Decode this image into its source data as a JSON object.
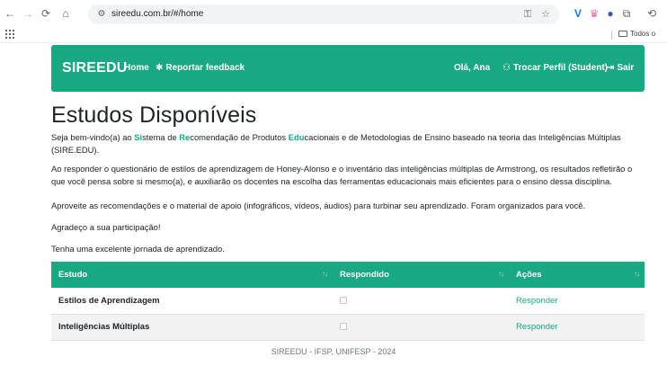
{
  "browser": {
    "url": "sireedu.com.br/#/home",
    "bookmark_folder": "Todos o"
  },
  "navbar": {
    "brand": "SIREEDU",
    "home": "Home",
    "feedback": "Reportar feedback",
    "greeting": "Olá, Ana",
    "switch_profile": "Trocar Perfil (Student)",
    "logout": "Sair"
  },
  "main": {
    "title": "Estudos Disponíveis",
    "intro": {
      "p1": "Seja bem-vindo(a) ao ",
      "si": "Si",
      "p2": "stema de ",
      "re": "Re",
      "p3": "comendação de Produtos ",
      "edu": "Edu",
      "p4": "cacionais e de Metodologias de Ensino baseado na teoria das Inteligências Múltiplas (SIRE.EDU)."
    },
    "paragraphs": [
      "Ao responder o questionário de estilos de aprendizagem de Honey-Alonso e o inventário das inteligências múltiplas de Armstrong, os resultados refletirão o que você pensa sobre si mesmo(a), e auxiliarão os docentes na escolha das ferramentas educacionais mais eficientes para o ensino dessa disciplina.",
      "Aproveite as recomendações e o material de apoio (infográficos, vídeos, áudios) para turbinar seu aprendizado. Foram organizados para você.",
      "Agradeço a sua participação!",
      "Tenha uma excelente jornada de aprendizado."
    ]
  },
  "table": {
    "headers": [
      "Estudo",
      "Respondido",
      "Ações"
    ],
    "sort_glyph": "↑↓",
    "rows": [
      {
        "study": "Estilos de Aprendizagem",
        "answered": false,
        "action": "Responder"
      },
      {
        "study": "Inteligências Múltiplas",
        "answered": false,
        "action": "Responder"
      }
    ]
  },
  "footer": "SIREEDU - IFSP, UNIFESP - 2024",
  "colors": {
    "brand_green": "#18a882"
  },
  "icons": {
    "back": "arrow-left-icon",
    "forward": "arrow-right-icon",
    "reload": "reload-icon",
    "home": "home-icon",
    "feedback": "bug-icon",
    "profile": "users-icon",
    "logout": "sign-out-icon"
  }
}
